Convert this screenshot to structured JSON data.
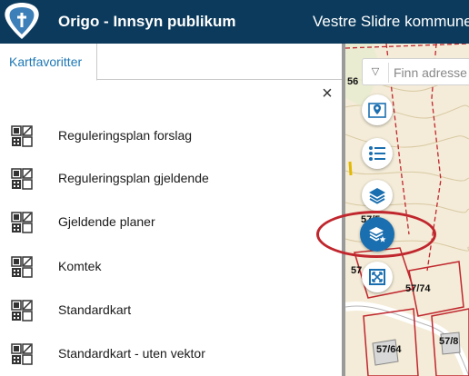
{
  "header": {
    "app_title": "Origo - Innsyn publikum",
    "municipality": "Vestre Slidre kommune",
    "background_color": "#0b3a5c",
    "logo_icon": "municipality-crest-icon"
  },
  "panel": {
    "tab_label": "Kartfavoritter",
    "close_label": "×",
    "favorites": [
      {
        "label": "Reguleringsplan forslag",
        "icon": "map-thumbnail-icon"
      },
      {
        "label": "Reguleringsplan gjeldende",
        "icon": "map-thumbnail-icon"
      },
      {
        "label": "Gjeldende planer",
        "icon": "map-thumbnail-icon"
      },
      {
        "label": "Komtek",
        "icon": "map-thumbnail-icon"
      },
      {
        "label": "Standardkart",
        "icon": "map-thumbnail-icon"
      },
      {
        "label": "Standardkart - uten vektor",
        "icon": "map-thumbnail-icon"
      }
    ]
  },
  "map": {
    "search_placeholder": "Finn adresse",
    "accent_color": "#1a6fb0",
    "highlight_color": "#c0262d",
    "tools": [
      {
        "name": "location-marker-tool",
        "icon": "map-pin-icon"
      },
      {
        "name": "legend-tool",
        "icon": "list-icon"
      },
      {
        "name": "layers-tool",
        "icon": "layers-icon"
      },
      {
        "name": "map-favorites-tool",
        "icon": "layers-star-icon",
        "active": true
      },
      {
        "name": "extent-tool",
        "icon": "extent-frame-icon"
      }
    ],
    "parcel_labels": [
      "56",
      "57/5",
      "57",
      "57/74",
      "57/64",
      "57/8"
    ]
  }
}
